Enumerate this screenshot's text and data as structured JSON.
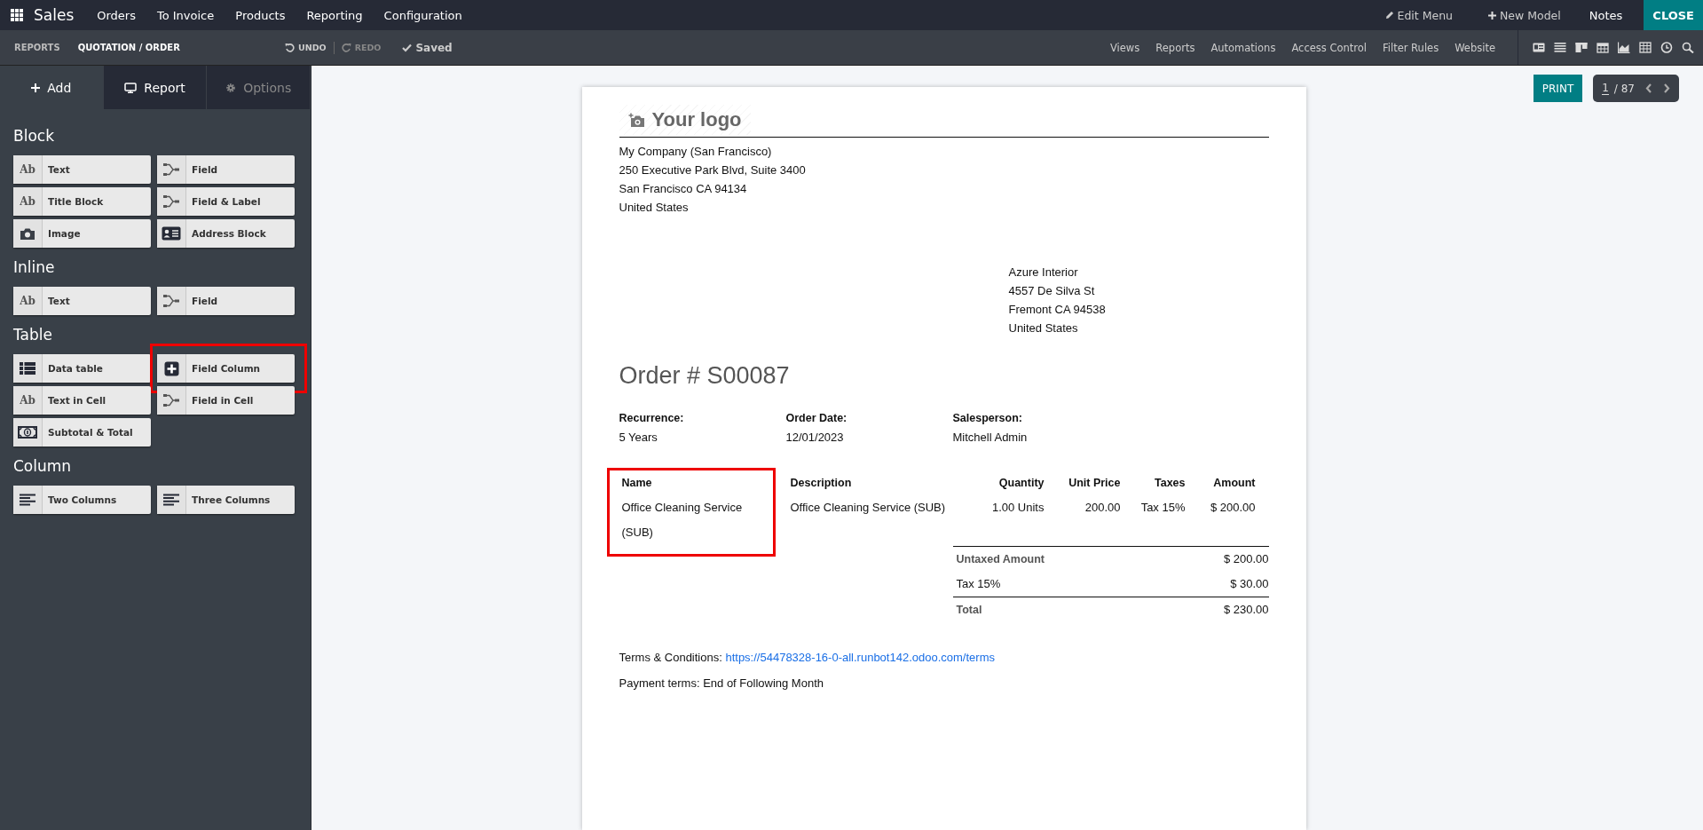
{
  "navbar": {
    "app": "Sales",
    "menu": [
      "Orders",
      "To Invoice",
      "Products",
      "Reporting",
      "Configuration"
    ],
    "edit_menu": "Edit Menu",
    "new_model": "New Model",
    "notes": "Notes",
    "close": "CLOSE"
  },
  "toolbar": {
    "breadcrumbs": [
      "REPORTS",
      "QUOTATION / ORDER"
    ],
    "undo": "UNDO",
    "redo": "REDO",
    "redo_disabled": true,
    "saved": "Saved",
    "links": [
      "Views",
      "Reports",
      "Automations",
      "Access Control",
      "Filter Rules",
      "Website"
    ]
  },
  "sidebar": {
    "tabs": [
      {
        "label": "Add",
        "kind": "add",
        "selected": true,
        "disabled": false
      },
      {
        "label": "Report",
        "kind": "report",
        "selected": false,
        "disabled": false
      },
      {
        "label": "Options",
        "kind": "options",
        "selected": false,
        "disabled": true
      }
    ],
    "sections": [
      {
        "title": "Block",
        "items": [
          {
            "label": "Text",
            "kind": "text",
            "icon_text": "Ab",
            "highlighted": false
          },
          {
            "label": "Field",
            "kind": "field",
            "highlighted": false
          },
          {
            "label": "Title Block",
            "kind": "text",
            "icon_text": "Ab",
            "highlighted": false
          },
          {
            "label": "Field & Label",
            "kind": "field",
            "highlighted": false
          },
          {
            "label": "Image",
            "kind": "image",
            "highlighted": false
          },
          {
            "label": "Address Block",
            "kind": "address",
            "highlighted": false
          }
        ]
      },
      {
        "title": "Inline",
        "items": [
          {
            "label": "Text",
            "kind": "text",
            "icon_text": "Ab",
            "highlighted": false
          },
          {
            "label": "Field",
            "kind": "field",
            "highlighted": false
          }
        ]
      },
      {
        "title": "Table",
        "items": [
          {
            "label": "Data table",
            "kind": "table",
            "highlighted": false
          },
          {
            "label": "Field Column",
            "kind": "plus",
            "highlighted": true
          },
          {
            "label": "Text in Cell",
            "kind": "text",
            "icon_text": "Ab",
            "highlighted": false
          },
          {
            "label": "Field in Cell",
            "kind": "field",
            "highlighted": false
          },
          {
            "label": "Subtotal & Total",
            "kind": "money",
            "highlighted": false
          }
        ]
      },
      {
        "title": "Column",
        "items": [
          {
            "label": "Two Columns",
            "kind": "columns",
            "highlighted": false
          },
          {
            "label": "Three Columns",
            "kind": "columns",
            "highlighted": false
          }
        ]
      }
    ]
  },
  "preview": {
    "print": "PRINT",
    "pager": {
      "current": "1",
      "rest": "/ 87"
    }
  },
  "document": {
    "logo": "Your logo",
    "company": [
      "My Company (San Francisco)",
      "250 Executive Park Blvd, Suite 3400",
      "San Francisco CA 94134",
      "United States"
    ],
    "partner": [
      "Azure Interior",
      "4557 De Silva St",
      "Fremont CA 94538",
      "United States"
    ],
    "title": "Order # S00087",
    "info": [
      {
        "label": "Recurrence:",
        "value": "5 Years"
      },
      {
        "label": "Order Date:",
        "value": "12/01/2023"
      },
      {
        "label": "Salesperson:",
        "value": "Mitchell Admin"
      }
    ],
    "table": {
      "columns": [
        {
          "label": "Name",
          "highlighted": true
        },
        {
          "label": "Description",
          "highlighted": false
        },
        {
          "label": "Quantity",
          "highlighted": false
        },
        {
          "label": "Unit Price",
          "highlighted": false
        },
        {
          "label": "Taxes",
          "highlighted": false
        },
        {
          "label": "Amount",
          "highlighted": false
        }
      ],
      "rows": [
        [
          "Office Cleaning Service (SUB)",
          "Office Cleaning Service (SUB)",
          "1.00 Units",
          "200.00",
          "Tax 15%",
          "$ 200.00"
        ]
      ]
    },
    "totals": [
      {
        "kind": "subtotal",
        "label": "Untaxed Amount",
        "value": "$ 200.00"
      },
      {
        "kind": "tax",
        "label": "Tax 15%",
        "value": "$ 30.00"
      },
      {
        "kind": "total",
        "label": "Total",
        "value": "$ 230.00"
      }
    ],
    "terms_label": "Terms & Conditions:",
    "terms_link": "https://54478328-16-0-all.runbot142.odoo.com/terms",
    "payment_terms": "Payment terms: End of Following Month"
  }
}
